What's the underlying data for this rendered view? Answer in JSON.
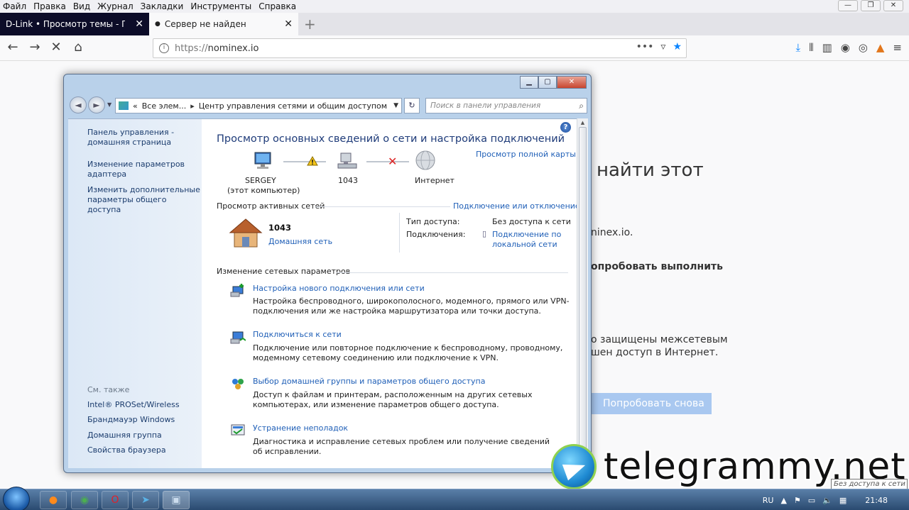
{
  "browser": {
    "menu": [
      "Файл",
      "Правка",
      "Вид",
      "Журнал",
      "Закладки",
      "Инструменты",
      "Справка"
    ],
    "tabs": [
      {
        "title": "D-Link • Просмотр темы - Попытка",
        "active": false
      },
      {
        "title": "Сервер не найден",
        "active": true
      }
    ],
    "url_proto": "https://",
    "url_host": "nominex.io"
  },
  "page_behind": {
    "heading_fragment": "найти этот",
    "host_fragment": "ninex.io.",
    "bold_fragment": "опробовать выполнить",
    "firewall_line1": "о защищены межсетевым",
    "firewall_line2": "шен доступ в Интернет.",
    "retry_button": "Попробовать снова"
  },
  "window": {
    "address": {
      "part1": "Все элем...",
      "part2": "Центр управления сетями и общим доступом",
      "search_placeholder": "Поиск в панели управления"
    },
    "left_pane": {
      "links": [
        "Панель управления - домашняя страница",
        "Изменение параметров адаптера",
        "Изменить дополнительные параметры общего доступа"
      ],
      "see_also_title": "См. также",
      "see_also": [
        "Intel® PROSet/Wireless",
        "Брандмауэр Windows",
        "Домашняя группа",
        "Свойства браузера"
      ]
    },
    "main": {
      "title": "Просмотр основных сведений о сети и настройка подключений",
      "full_map_link": "Просмотр полной карты",
      "map_nodes": {
        "computer_name": "SERGEY",
        "computer_sub": "(этот компьютер)",
        "network": "1043",
        "internet": "Интернет"
      },
      "active_networks_title": "Просмотр активных сетей",
      "connect_disconnect_link": "Подключение или отключение",
      "network_name": "1043",
      "network_type_link": "Домашняя сеть",
      "access_type_label": "Тип доступа:",
      "access_type_value": "Без доступа к сети",
      "connections_label": "Подключения:",
      "connections_value": "Подключение по локальной сети",
      "change_settings_title": "Изменение сетевых параметров",
      "tasks": [
        {
          "link": "Настройка нового подключения или сети",
          "desc": "Настройка беспроводного, широкополосного, модемного, прямого или VPN-подключения или же настройка маршрутизатора или точки доступа."
        },
        {
          "link": "Подключиться к сети",
          "desc": "Подключение или повторное подключение к беспроводному, проводному, модемному сетевому соединению или подключение к VPN."
        },
        {
          "link": "Выбор домашней группы и параметров общего доступа",
          "desc": "Доступ к файлам и принтерам, расположенным на других сетевых компьютерах, или изменение параметров общего доступа."
        },
        {
          "link": "Устранение неполадок",
          "desc": "Диагностика и исправление сетевых проблем или получение сведений об исправлении."
        }
      ]
    }
  },
  "taskbar": {
    "lang": "RU",
    "time": "21:48",
    "tooltip": "Без доступа к сети"
  },
  "watermark": "telegrammy.net"
}
